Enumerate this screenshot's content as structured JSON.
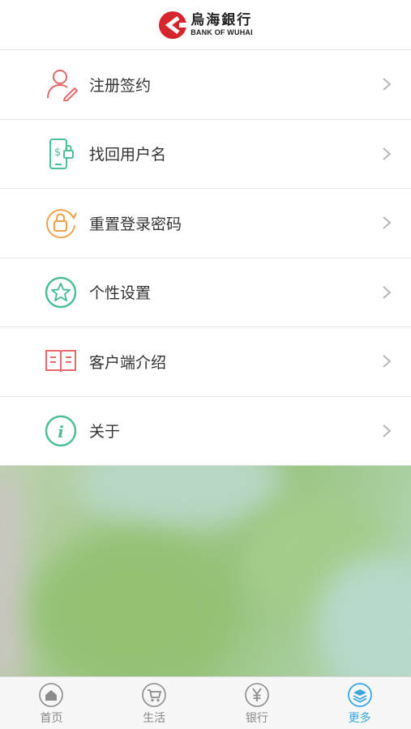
{
  "header": {
    "logo_cn": "烏海銀行",
    "logo_en": "BANK OF WUHAI"
  },
  "menu": [
    {
      "label": "注册签约",
      "icon": "register-user-icon"
    },
    {
      "label": "找回用户名",
      "icon": "phone-lock-icon"
    },
    {
      "label": "重置登录密码",
      "icon": "reset-password-icon"
    },
    {
      "label": "个性设置",
      "icon": "star-icon"
    },
    {
      "label": "客户端介绍",
      "icon": "book-icon"
    },
    {
      "label": "关于",
      "icon": "info-icon"
    }
  ],
  "tabs": [
    {
      "label": "首页",
      "icon": "home-icon",
      "active": false
    },
    {
      "label": "生活",
      "icon": "cart-icon",
      "active": false
    },
    {
      "label": "银行",
      "icon": "yuan-icon",
      "active": false
    },
    {
      "label": "更多",
      "icon": "layers-icon",
      "active": true
    }
  ],
  "colors": {
    "brand_red": "#d6252d",
    "icon_red": "#e4696a",
    "icon_green": "#4dbd9a",
    "icon_orange": "#f0a04b",
    "active_blue": "#3aa7e0",
    "inactive_gray": "#888888"
  }
}
